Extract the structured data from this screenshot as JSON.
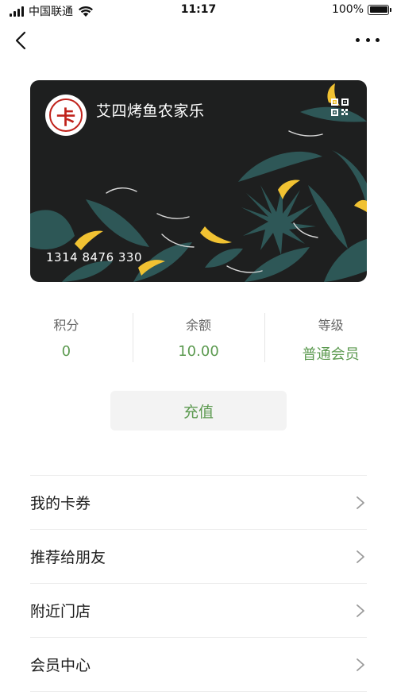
{
  "status_bar": {
    "carrier": "中国联通",
    "time": "11:17",
    "battery": "100%",
    "signal_bars": 4,
    "icons": [
      "signal-icon",
      "wifi-icon",
      "battery-icon"
    ]
  },
  "nav": {
    "back_icon": "chevron-left-icon",
    "more_icon": "more-dots-icon"
  },
  "card": {
    "logo_char": "卡",
    "store_name": "艾四烤鱼农家乐",
    "qr_icon": "qr-code-icon",
    "card_number": "1314 8476 330",
    "background_color": "#1e1f1f",
    "leaf_color": "#2f5b5a",
    "banana_color": "#f1c232",
    "logo_ring_color": "#c0221b"
  },
  "stats": [
    {
      "label": "积分",
      "value": "0"
    },
    {
      "label": "余额",
      "value": "10.00"
    },
    {
      "label": "等级",
      "value": "普通会员"
    }
  ],
  "recharge": {
    "label": "充值"
  },
  "menu": [
    {
      "label": "我的卡券"
    },
    {
      "label": "推荐给朋友"
    },
    {
      "label": "附近门店"
    },
    {
      "label": "会员中心"
    }
  ],
  "colors": {
    "accent_green": "#5c9a50",
    "divider": "#ececec",
    "button_bg": "#f3f3f3"
  }
}
